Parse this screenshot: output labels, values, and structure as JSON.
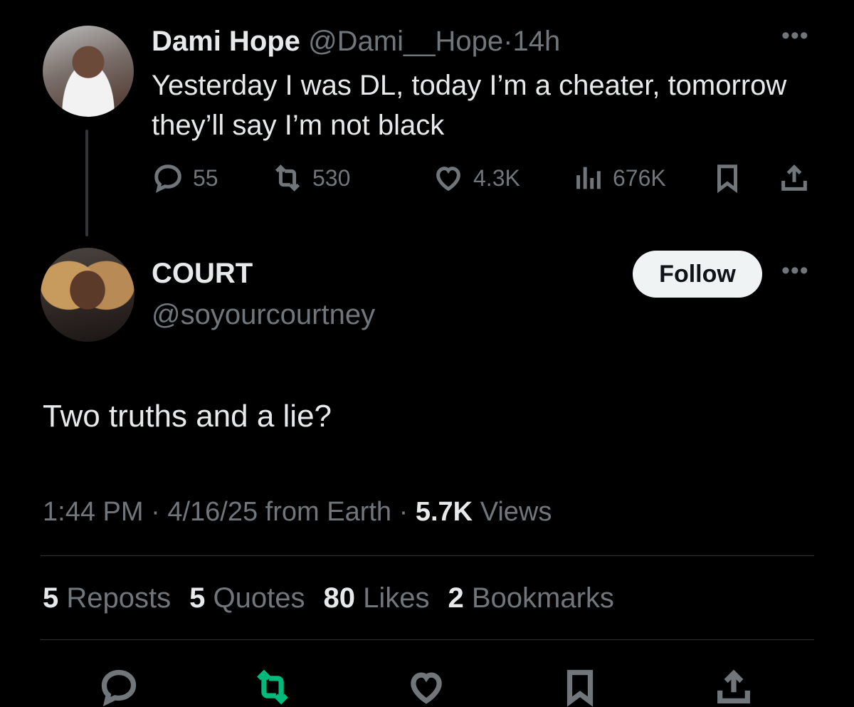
{
  "parent_tweet": {
    "display_name": "Dami Hope",
    "handle": "@Dami__Hope",
    "separator": "·",
    "time_ago": "14h",
    "text": "Yesterday I was DL, today I’m a cheater, tomorrow they’ll say I’m not black",
    "replies": "55",
    "reposts": "530",
    "likes": "4.3K",
    "views": "676K",
    "icons": [
      "reply-icon",
      "repost-icon",
      "like-icon",
      "views-icon",
      "bookmark-icon",
      "share-icon"
    ]
  },
  "main_tweet": {
    "display_name": "COURT",
    "handle": "@soyourcourtney",
    "follow_label": "Follow",
    "text": "Two truths and a lie?",
    "time": "1:44 PM",
    "date": "4/16/25",
    "source": "from Earth",
    "views_count": "5.7K",
    "views_label": "Views",
    "dot": "·",
    "stats": {
      "reposts_count": "5",
      "reposts_label": "Reposts",
      "quotes_count": "5",
      "quotes_label": "Quotes",
      "likes_count": "80",
      "likes_label": "Likes",
      "bookmarks_count": "2",
      "bookmarks_label": "Bookmarks"
    }
  },
  "more_label": "•••",
  "colors": {
    "background": "#000000",
    "text": "#e7e9ea",
    "muted": "#71767b",
    "repost_active": "#00ba7c",
    "divider": "#2f3336"
  }
}
